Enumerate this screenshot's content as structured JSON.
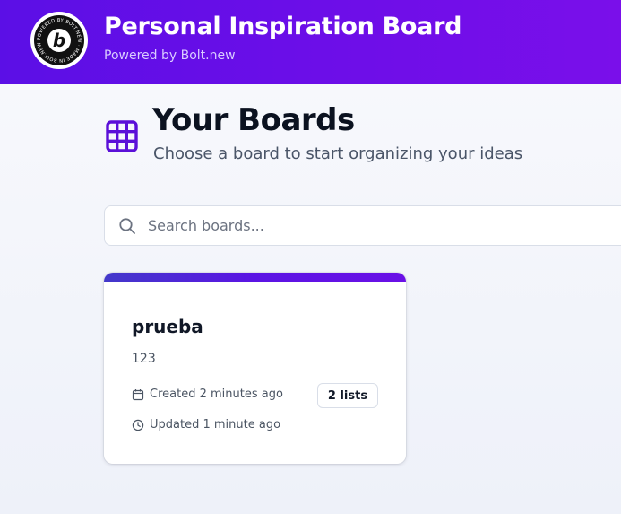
{
  "header": {
    "title": "Personal Inspiration Board",
    "subtitle": "Powered by Bolt.new",
    "logo": {
      "ring_text": "POWERED BY BOLT.NEW · MADE IN BOLT.NEW ·",
      "letter": "b"
    }
  },
  "main": {
    "title": "Your Boards",
    "subtitle": "Choose a board to start organizing your ideas",
    "title_icon": "grid-icon"
  },
  "search": {
    "placeholder": "Search boards...",
    "value": "",
    "icon": "search-icon"
  },
  "boards": [
    {
      "title": "prueba",
      "description": "123",
      "created": "Created 2 minutes ago",
      "updated": "Updated 1 minute ago",
      "lists_badge": "2 lists"
    }
  ],
  "colors": {
    "header_start": "#5b0fe6",
    "header_end": "#7a0fea",
    "accent": "#5b14e4",
    "icon_purple": "#5b10d8"
  }
}
